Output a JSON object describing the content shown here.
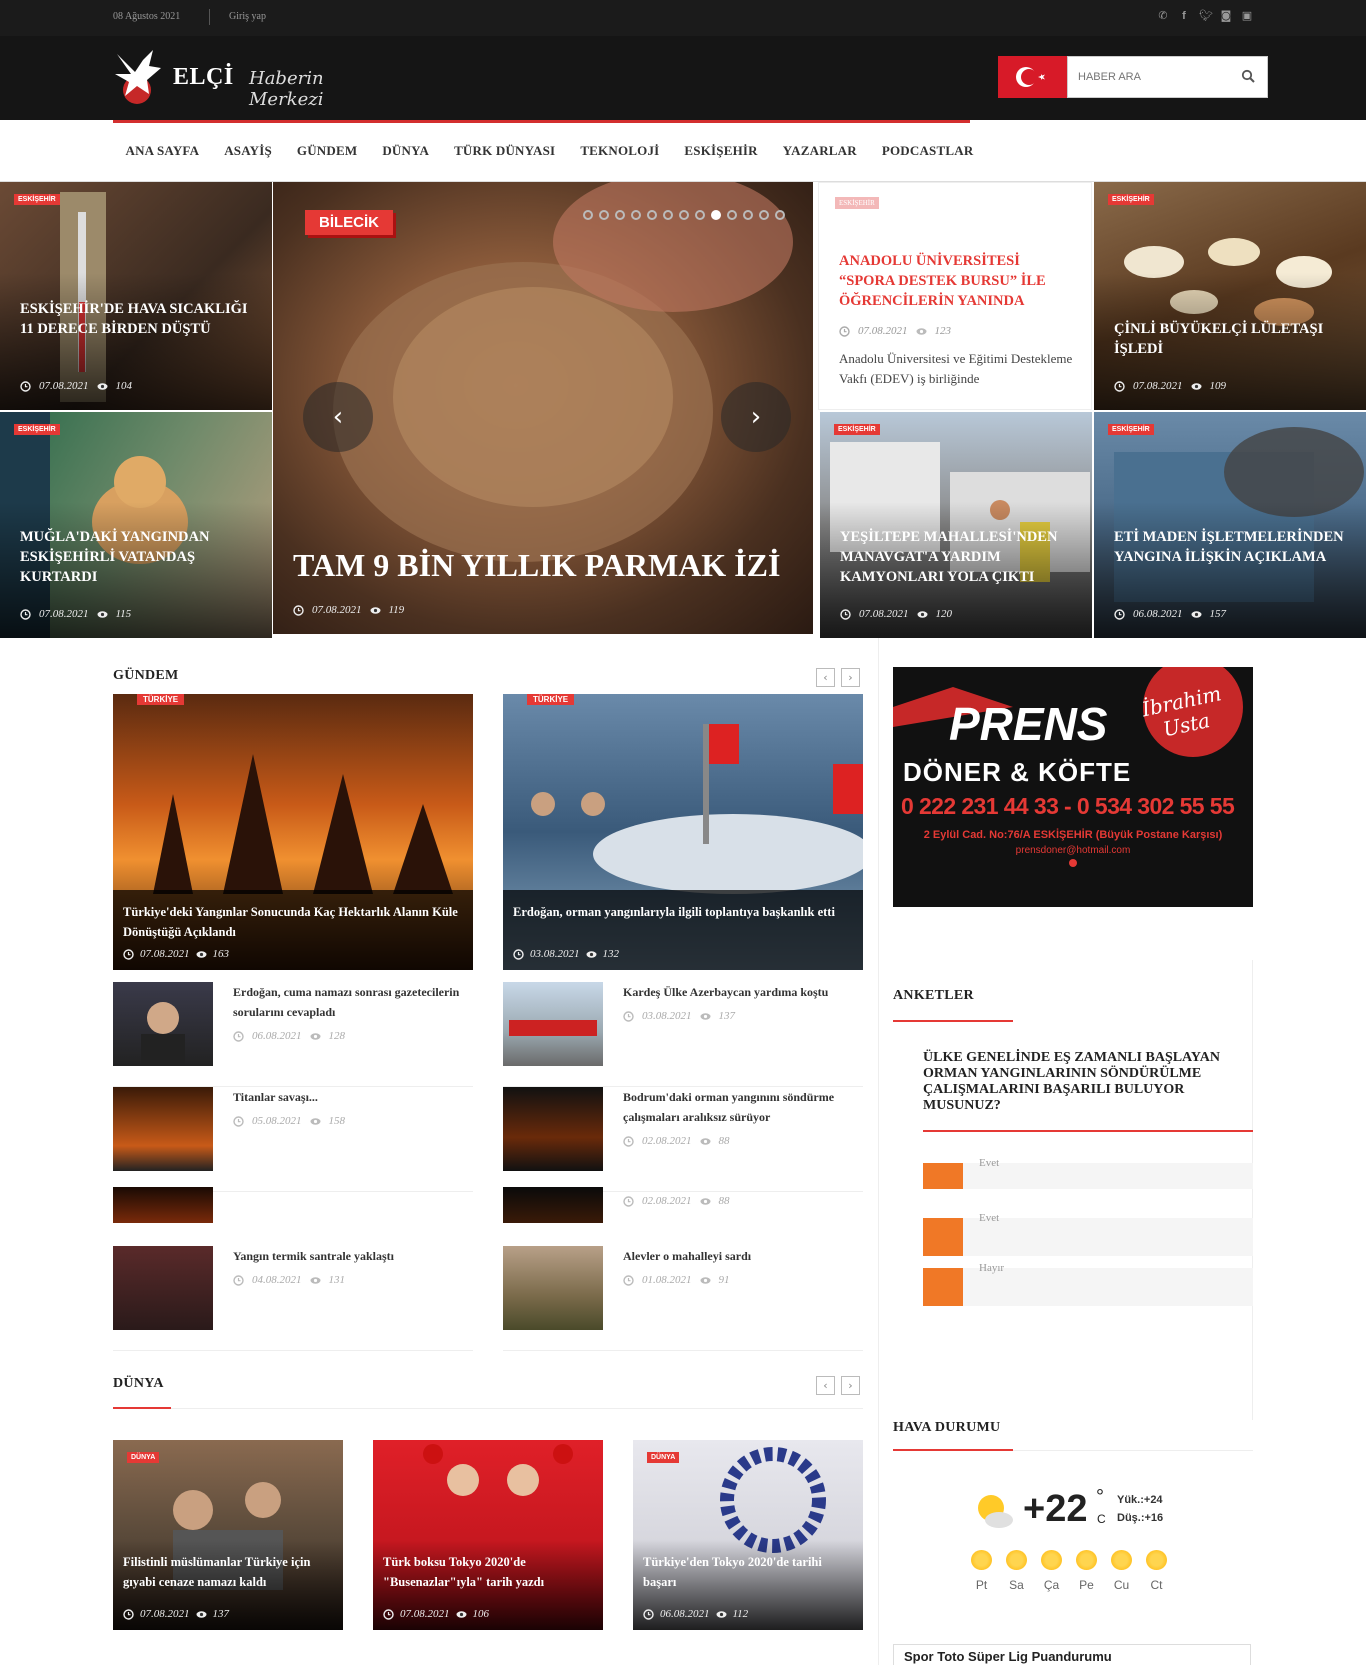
{
  "topbar": {
    "date": "08 Ağustos 2021",
    "login": "Giriş yap",
    "social": [
      "whatsapp-icon",
      "facebook-icon",
      "twitter-icon",
      "instagram-icon",
      "youtube-icon"
    ]
  },
  "header": {
    "logo_name": "ELÇİ",
    "logo_slogan": "Haberin Merkezi",
    "search_placeholder": "HABER ARA"
  },
  "nav": {
    "items": [
      "ANA SAYFA",
      "ASAYİŞ",
      "GÜNDEM",
      "DÜNYA",
      "TÜRK DÜNYASI",
      "TEKNOLOJİ",
      "ESKİŞEHİR",
      "YAZARLAR",
      "PODCASTLAR"
    ]
  },
  "hero": {
    "tiles": [
      {
        "badge": "ESKİŞEHİR",
        "title": "ESKİŞEHİR'DE HAVA SICAKLIĞI 11 DERECE BİRDEN DÜŞTÜ",
        "date": "07.08.2021",
        "views": "104"
      },
      {
        "badge": "ESKİŞEHİR",
        "title": "MUĞLA'DAKİ YANGINDAN ESKİŞEHİRLİ VATANDAŞ KURTARDI",
        "date": "07.08.2021",
        "views": "115"
      },
      {
        "badge": "ESKİŞEHİR",
        "title": "ÇİNLİ BÜYÜKELÇİ LÜLETAŞI İŞLEDİ",
        "date": "07.08.2021",
        "views": "109"
      },
      {
        "badge": "ESKİŞEHİR",
        "title": "YEŞİLTEPE MAHALLESİ'NDEN MANAVGAT'A YARDIM KAMYONLARI YOLA ÇIKTI",
        "date": "07.08.2021",
        "views": "120"
      },
      {
        "badge": "ESKİŞEHİR",
        "title": "ETİ MADEN İŞLETMELERİNDEN YANGINA İLİŞKİN AÇIKLAMA",
        "date": "06.08.2021",
        "views": "157"
      }
    ],
    "slider": {
      "badge": "BİLECİK",
      "title": "TAM 9 BİN YILLIK PARMAK İZİ",
      "date": "07.08.2021",
      "views": "119",
      "dot_count": 13,
      "active_dot": 8
    },
    "white_card": {
      "badge": "ESKİŞEHİR",
      "title": "ANADOLU ÜNİVERSİTESİ “SPORA DESTEK BURSU” İLE ÖĞRENCİLERİN YANINDA",
      "date": "07.08.2021",
      "views": "123",
      "excerpt": "Anadolu Üniversitesi ve Eğitimi Destekleme Vakfı (EDEV) iş birliğinde"
    }
  },
  "gundem": {
    "title": "GÜNDEM",
    "big": [
      {
        "badge": "TÜRKİYE",
        "title": "Türkiye'deki Yangınlar Sonucunda Kaç Hektarlık Alanın Küle Dönüştüğü Açıklandı",
        "date": "07.08.2021",
        "views": "163"
      },
      {
        "badge": "TÜRKİYE",
        "title": "Erdoğan, orman yangınlarıyla ilgili toplantıya başkanlık etti",
        "date": "03.08.2021",
        "views": "132"
      }
    ],
    "left_list": [
      {
        "title": "Erdoğan, cuma namazı sonrası gazetecilerin sorularını cevapladı",
        "date": "06.08.2021",
        "views": "128"
      },
      {
        "title": "Titanlar savaşı...",
        "date": "05.08.2021",
        "views": "158"
      },
      {
        "title": "",
        "date": "",
        "views": ""
      },
      {
        "title": "Yangın termik santrale yaklaştı",
        "date": "04.08.2021",
        "views": "131"
      }
    ],
    "right_list": [
      {
        "title": "Kardeş Ülke Azerbaycan yardıma koştu",
        "date": "03.08.2021",
        "views": "137"
      },
      {
        "title": "Bodrum'daki orman yangınını söndürme çalışmaları aralıksız sürüyor",
        "date": "02.08.2021",
        "views": "88"
      },
      {
        "title": "",
        "date": "02.08.2021",
        "views": "88"
      },
      {
        "title": "Alevler o mahalleyi sardı",
        "date": "01.08.2021",
        "views": "91"
      }
    ]
  },
  "ad": {
    "brand": "PRENS",
    "sub": "DÖNER & KÖFTE",
    "signature": "İbrahim Usta",
    "phones": "0 222 231 44 33 - 0 534 302 55 55",
    "address": "2 Eylül Cad. No:76/A ESKİŞEHİR (Büyük Postane Karşısı)",
    "email": "prensdoner@hotmail.com"
  },
  "anketler": {
    "title": "ANKETLER",
    "question": "ÜLKE GENELİNDE EŞ ZAMANLI BAŞLAYAN ORMAN YANGINLARININ SÖNDÜRÜLME ÇALIŞMALARINI BAŞARILI BULUYOR MUSUNUZ?",
    "options": [
      {
        "label": "Evet",
        "fraction": 0.12
      },
      {
        "label": "Evet",
        "fraction": 0.12
      },
      {
        "label": "Hayır",
        "fraction": 0.12
      }
    ]
  },
  "weather": {
    "title": "HAVA DURUMU",
    "temp": "+22",
    "unit_deg": "°",
    "unit_c": "C",
    "high": "Yük.:+24",
    "low": "Düş.:+16",
    "days": [
      "Pt",
      "Sa",
      "Ça",
      "Pe",
      "Cu",
      "Ct"
    ]
  },
  "league": {
    "title": "Spor Toto Süper Lig Puandurumu"
  },
  "dunya": {
    "title": "DÜNYA",
    "cards": [
      {
        "badge": "DÜNYA",
        "title": "Filistinli müslümanlar Türkiye için gıyabi cenaze namazı kaldı",
        "date": "07.08.2021",
        "views": "137"
      },
      {
        "badge": "DÜNYA",
        "title": "Türk boksu Tokyo 2020'de \"Busenazlar\"ıyla\" tarih yazdı",
        "date": "07.08.2021",
        "views": "106"
      },
      {
        "badge": "DÜNYA",
        "title": "Türkiye'den Tokyo 2020'de tarihi başarı",
        "date": "06.08.2021",
        "views": "112"
      }
    ]
  },
  "colors": {
    "accent": "#e53935",
    "poll": "#f07826",
    "dark": "#151515"
  }
}
